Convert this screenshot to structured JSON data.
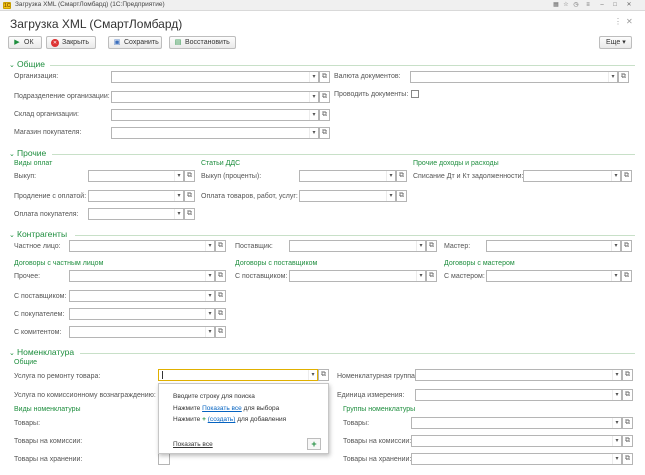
{
  "window": {
    "title": "Загрузка XML (СмартЛомбард) (1С:Предприятие)",
    "logo": "1С"
  },
  "form": {
    "title": "Загрузка XML (СмартЛомбард)"
  },
  "toolbar": {
    "ok": "ОК",
    "close": "Закрыть",
    "save": "Сохранить",
    "restore": "Восстановить",
    "more": "Еще"
  },
  "general": {
    "header": "Общие",
    "org_label": "Организация:",
    "dept_label": "Подразделение организации:",
    "warehouse_label": "Склад организации:",
    "shop_label": "Магазин покупателя:",
    "currency_label": "Валюта документов:",
    "post_label": "Проводить документы:"
  },
  "other": {
    "header": "Прочие",
    "payment_types": "Виды оплат",
    "buyout_label": "Выкуп:",
    "extension_label": "Продление с оплатой:",
    "buyer_payment_label": "Оплата покупателя:",
    "dds_items": "Статьи ДДС",
    "buyout_interest_label": "Выкуп (проценты):",
    "payment_goods_label": "Оплата товаров, работ, услуг:",
    "other_income": "Прочие доходы и расходы",
    "writeoff_label": "Списание Дт и Кт задолженности:"
  },
  "contractors": {
    "header": "Контрагенты",
    "private_label": "Частное лицо:",
    "supplier_label": "Поставщик:",
    "master_label": "Мастер:",
    "private_contracts": "Договоры с частным лицом",
    "supplier_contracts": "Договоры с поставщиком",
    "master_contracts": "Договоры с мастером",
    "other_label": "Прочее:",
    "with_supplier_label": "С поставщиком:",
    "with_buyer_label": "С покупателем:",
    "with_consignor_label": "С комитентом:",
    "with_supplier2_label": "С поставщиком:",
    "with_master_label": "С мастером:"
  },
  "nomenclature": {
    "header": "Номенклатура",
    "general": "Общие",
    "repair_service_label": "Услуга по ремонту товара:",
    "commission_service_label": "Услуга по комиссионному вознаграждению:",
    "nom_group_label": "Номенклатурная группа:",
    "unit_label": "Единица измерения:",
    "nom_types": "Виды номенклатуры",
    "goods_label": "Товары:",
    "goods_commission_label": "Товары на комиссии:",
    "goods_storage_label": "Товары на хранении:",
    "nom_groups": "Группы номенклатуры",
    "goods2_label": "Товары:",
    "goods_commission2_label": "Товары на комиссии:",
    "goods_storage2_label": "Товары на хранении:"
  },
  "popup": {
    "hint": "Вводите строку для поиска",
    "press1": "Нажмите",
    "show_all_link": "Показать все",
    "for_select": "для выбора",
    "press2": "Нажмите",
    "create_link": "(создать)",
    "for_add": "для добавления",
    "show_all_bottom": "Показать все"
  }
}
